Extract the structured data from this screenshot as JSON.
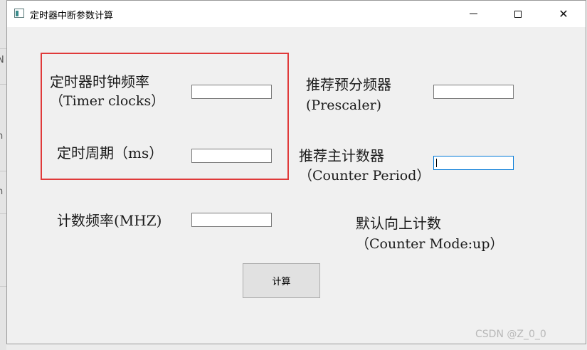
{
  "window": {
    "title": "定时器中断参数计算",
    "controls": {
      "minimize": "minimize-icon",
      "maximize": "maximize-icon",
      "close": "close-icon"
    }
  },
  "background": {
    "side_glyph_1": "N",
    "side_glyph_2": "n",
    "side_glyph_3": "n"
  },
  "form": {
    "timer_clock_label_1": "定时器时钟频率",
    "timer_clock_label_2": "（Timer clocks）",
    "timer_clock_value": "",
    "period_label": "定时周期（ms）",
    "period_value": "",
    "count_freq_label": "计数频率(MHZ)",
    "count_freq_value": "",
    "prescaler_label_1": "推荐预分频器",
    "prescaler_label_2": "(Prescaler)",
    "prescaler_value": "",
    "counter_period_label_1": "推荐主计数器",
    "counter_period_label_2": "（Counter Period）",
    "counter_period_value": "",
    "counter_mode_label_1": "默认向上计数",
    "counter_mode_label_2": "（Counter Mode:up）",
    "calculate_button": "计算"
  },
  "colors": {
    "highlight_box": "#e03a3a",
    "focus": "#0078d7"
  },
  "watermark": "CSDN @Z_0_0"
}
